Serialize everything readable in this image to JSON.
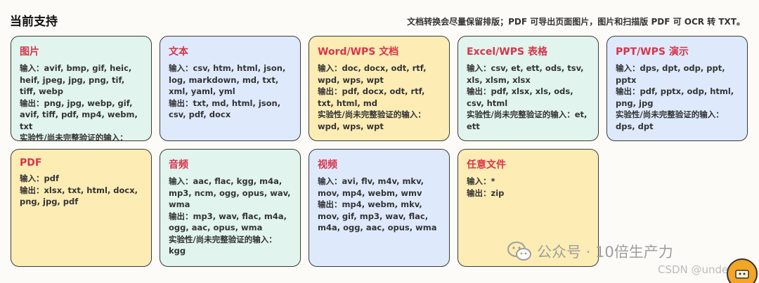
{
  "header": {
    "title": "当前支持",
    "note": "文档转换会尽量保留排版；PDF 可导出页面图片，图片和扫描版 PDF 可 OCR 转 TXT。"
  },
  "cards": [
    {
      "title": "图片",
      "lines": [
        "输入：avif, bmp, gif, heic, heif, jpeg, jpg, png, tif, tiff, webp",
        "输出：png, jpg, webp, gif, avif, tiff, pdf, mp4, webm, txt",
        "实验性/尚未完整验证的输入：heic, heif"
      ]
    },
    {
      "title": "文本",
      "lines": [
        "输入：csv, htm, html, json, log, markdown, md, txt, xml, yaml, yml",
        "输出：txt, md, html, json, csv, pdf, docx"
      ]
    },
    {
      "title": "Word/WPS 文档",
      "lines": [
        "输入：doc, docx, odt, rtf, wpd, wps, wpt",
        "输出：pdf, docx, odt, rtf, txt, html, md",
        "实验性/尚未完整验证的输入：wpd, wps, wpt"
      ]
    },
    {
      "title": "Excel/WPS 表格",
      "lines": [
        "输入：csv, et, ett, ods, tsv, xls, xlsm, xlsx",
        "输出：pdf, xlsx, xls, ods, csv, html",
        "实验性/尚未完整验证的输入：et, ett"
      ]
    },
    {
      "title": "PPT/WPS 演示",
      "lines": [
        "输入：dps, dpt, odp, ppt, pptx",
        "输出：pdf, pptx, odp, html, png, jpg",
        "实验性/尚未完整验证的输入：dps, dpt"
      ]
    },
    {
      "title": "PDF",
      "lines": [
        "输入：pdf",
        "输出：xlsx, txt, html, docx, png, jpg, pdf"
      ]
    },
    {
      "title": "音频",
      "lines": [
        "输入：aac, flac, kgg, m4a, mp3, ncm, ogg, opus, wav, wma",
        "输出：mp3, wav, flac, m4a, ogg, aac, opus, wma",
        "实验性/尚未完整验证的输入：kgg"
      ]
    },
    {
      "title": "视频",
      "lines": [
        "输入：avi, flv, m4v, mkv, mov, mp4, webm, wmv",
        "输出：mp4, webm, mkv, mov, gif, mp3, wav, flac, m4a, ogg, aac, opus, wma"
      ]
    },
    {
      "title": "任意文件",
      "lines": [
        "输入：*",
        "输出：zip"
      ]
    }
  ],
  "watermark": {
    "wechat": "公众号 · 10倍生产力",
    "csdn": "CSDN @undefined"
  },
  "colors": {
    "card_title": "#d8344a",
    "green": "#e1f4ee",
    "blue": "#deeafc",
    "yellow": "#fdedb5",
    "avatar": "#f3a526"
  }
}
